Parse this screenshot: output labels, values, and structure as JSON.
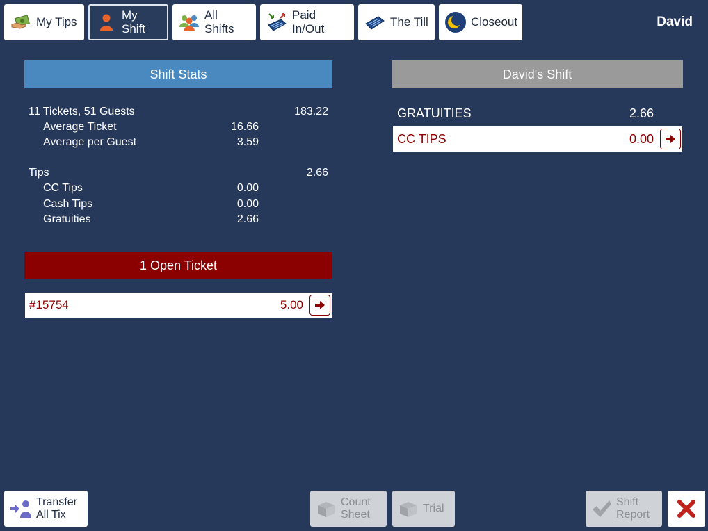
{
  "topbar": {
    "tabs": [
      {
        "label": "My Tips",
        "icon": "money-hand-icon",
        "active": false
      },
      {
        "label": "My Shift",
        "icon": "person-icon",
        "active": true
      },
      {
        "label": "All Shifts",
        "icon": "group-icon",
        "active": false
      },
      {
        "label": "Paid In/Out",
        "icon": "cash-register-arrows-icon",
        "active": false
      },
      {
        "label": "The Till",
        "icon": "till-icon",
        "active": false
      },
      {
        "label": "Closeout",
        "icon": "moon-icon",
        "active": false
      }
    ],
    "user": "David"
  },
  "shift_stats": {
    "header": "Shift Stats",
    "summary_label": "11 Tickets, 51 Guests",
    "summary_value": "183.22",
    "average_ticket_label": "Average Ticket",
    "average_ticket_value": "16.66",
    "average_guest_label": "Average per Guest",
    "average_guest_value": "3.59",
    "tips_label": "Tips",
    "tips_value": "2.66",
    "cc_tips_label": "CC Tips",
    "cc_tips_value": "0.00",
    "cash_tips_label": "Cash Tips",
    "cash_tips_value": "0.00",
    "gratuities_label": "Gratuities",
    "gratuities_value": "2.66"
  },
  "open_tickets": {
    "header": "1 Open Ticket",
    "items": [
      {
        "number": "#15754",
        "amount": "5.00"
      }
    ]
  },
  "user_shift": {
    "header": "David's Shift",
    "gratuities_label": "GRATUITIES",
    "gratuities_value": "2.66",
    "cc_tips_label": "CC TIPS",
    "cc_tips_value": "0.00"
  },
  "bottom": {
    "transfer_line1": "Transfer",
    "transfer_line2": "All Tix",
    "count_line1": "Count",
    "count_line2": "Sheet",
    "trial_label": "Trial",
    "report_line1": "Shift",
    "report_line2": "Report"
  },
  "colors": {
    "background": "#27395a",
    "stats_header": "#4a88c0",
    "open_ticket_header": "#8b0000",
    "shift_header": "#9a9a9a",
    "accent_red": "#8b0000"
  }
}
